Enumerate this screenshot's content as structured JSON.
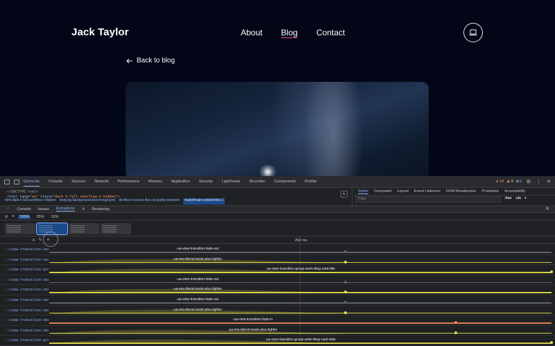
{
  "site": {
    "brand": "Jack Taylor",
    "nav": [
      {
        "label": "About",
        "active": false
      },
      {
        "label": "Blog",
        "active": true
      },
      {
        "label": "Contact",
        "active": false
      }
    ],
    "back_link": "Back to blog",
    "theme_icon": "laptop-icon"
  },
  "devtools": {
    "tabs": [
      "Elements",
      "Console",
      "Sources",
      "Network",
      "Performance",
      "Memory",
      "Application",
      "Security",
      "Lighthouse",
      "Recorder",
      "Components",
      "Profiler"
    ],
    "selected_tab": "Elements",
    "errors": "14",
    "warnings": "6",
    "infos": "6",
    "dom_line1": "<!DOCTYPE html>",
    "dom_line2_tag": "<html",
    "dom_line2_attr1": "lang=",
    "dom_line2_val1": "\"en\"",
    "dom_line2_attr2": "class=",
    "dom_line2_val2": "\"dark h-full overflow-x-hidden\"",
    "dom_line2_end": ">",
    "breadcrumbs": [
      "html.dark.h-full.overflow-x-hidden",
      "body.bg-background.text-foreground",
      "div.flex.h-screen.flex-col.justify-between",
      "main#main-content.flex-1"
    ],
    "styles_tabs": [
      "Styles",
      "Computed",
      "Layout",
      "Event Listeners",
      "DOM Breakpoints",
      "Properties",
      "Accessibility"
    ],
    "filter_placeholder": "Filter",
    "hov": ":hov",
    "cls": ".cls",
    "drawer_tabs": [
      "Console",
      "Issues",
      "Animations",
      "Rendering"
    ],
    "drawer_selected": "Animations",
    "speeds": [
      "100%",
      "25%",
      "10%"
    ],
    "timeline_marker": "250 ms",
    "timeline_zero": "0"
  },
  "animations": [
    {
      "selector": "::view-transition-image-pair(anim-blog-card-image)",
      "name": "-ua-view-transition-fade-out",
      "color": "#5f6368",
      "kind": "plain",
      "end": 0.59
    },
    {
      "selector": "::view-transition-image-pair(anim-blog-card-image)",
      "name": "-ua-mix-blend-mode-plus-lighter",
      "color": "#e5e04a",
      "kind": "hump",
      "end": 0.59
    },
    {
      "selector": "::view-transition-group(anim-blog-card-title)",
      "name": "-ua-view-transition-group-anim-blog-card-title",
      "color": "#e5e04a",
      "kind": "hump",
      "end": 1.0
    },
    {
      "selector": "::view-transition-image-pair(anim-blog-card-title)",
      "name": "-ua-view-transition-fade-out",
      "color": "#5f6368",
      "kind": "plain",
      "end": 0.59
    },
    {
      "selector": "::view-transition-image-pair(anim-blog-card-title)",
      "name": "-ua-mix-blend-mode-plus-lighter",
      "color": "#e5e04a",
      "kind": "hump",
      "end": 0.59
    },
    {
      "selector": "::view-transition-image-pair(root)",
      "name": "-ua-view-transition-fade-out",
      "color": "#5f6368",
      "kind": "plain",
      "end": 0.59
    },
    {
      "selector": "::view-transition-image-pair(root)",
      "name": "-ua-mix-blend-mode-plus-lighter",
      "color": "#e5e04a",
      "kind": "hump",
      "end": 0.59
    },
    {
      "selector": "::view-transition-image-pair(root)",
      "name": "-ua-view-transition-fade-in",
      "color": "#f28b54",
      "kind": "plain",
      "end": 0.81
    },
    {
      "selector": "::view-transition-image-pair(anim-blog-card-date)",
      "name": "-ua-mix-blend-mode-plus-lighter",
      "color": "#e5e04a",
      "kind": "hump",
      "end": 0.81
    },
    {
      "selector": "::view-transition-group(anim-blog-card-date)",
      "name": "-ua-view-transition-group-anim-blog-card-date",
      "color": "#e5e04a",
      "kind": "hump",
      "end": 1.0
    }
  ]
}
